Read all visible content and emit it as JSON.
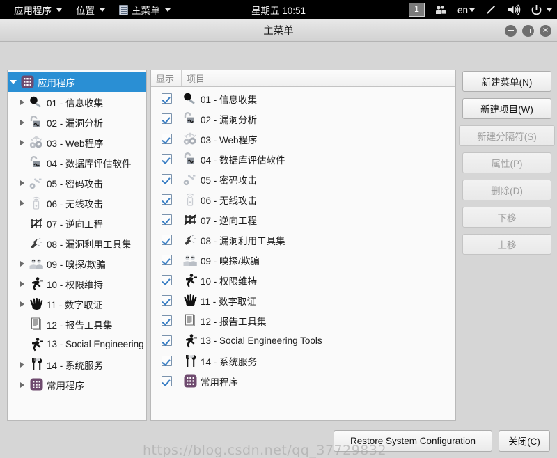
{
  "top_panel": {
    "applications_label": "应用程序",
    "places_label": "位置",
    "main_menu_label": "主菜单",
    "main_menu_icon": "document-list-icon",
    "clock": "星期五 10:51",
    "workspace": "1",
    "video_icon": "video-camera-icon",
    "keyboard_layout": "en",
    "pen_icon": "pen-icon",
    "volume_icon": "speaker-icon",
    "power_icon": "power-icon"
  },
  "window": {
    "title": "主菜单",
    "minimize_icon": "minimize-icon",
    "maximize_icon": "maximize-icon",
    "close_icon": "close-icon"
  },
  "right_table": {
    "columns": [
      "显示",
      "项目"
    ]
  },
  "tree": {
    "root": {
      "label": "应用程序",
      "icon": "app-grid-icon",
      "selected": true,
      "expanded": true
    },
    "items": [
      {
        "label": "01 - 信息收集",
        "icon": "magnifier-icon",
        "expander": true,
        "checked": true
      },
      {
        "label": "02 - 漏洞分析",
        "icon": "padlock-open-icon",
        "expander": true,
        "checked": true
      },
      {
        "label": "03 - Web程序",
        "icon": "spider-gears-icon",
        "expander": true,
        "checked": true
      },
      {
        "label": "04 - 数据库评估软件",
        "icon": "padlock-open-icon",
        "expander": false,
        "checked": true
      },
      {
        "label": "05 - 密码攻击",
        "icon": "key-icon",
        "expander": true,
        "checked": true
      },
      {
        "label": "06 - 无线攻击",
        "icon": "wireless-icon",
        "expander": true,
        "checked": true
      },
      {
        "label": "07 - 逆向工程",
        "icon": "gears-bug-icon",
        "expander": false,
        "checked": true
      },
      {
        "label": "08 - 漏洞利用工具集",
        "icon": "lightning-icon",
        "expander": false,
        "checked": true
      },
      {
        "label": "09 - 嗅探/欺骗",
        "icon": "faces-icon",
        "expander": true,
        "checked": true
      },
      {
        "label": "10 - 权限维持",
        "icon": "running-man-icon",
        "expander": true,
        "checked": true
      },
      {
        "label": "11 - 数字取证",
        "icon": "open-hand-icon",
        "expander": true,
        "checked": true
      },
      {
        "label": "12 - 报告工具集",
        "icon": "documents-icon",
        "expander": false,
        "checked": true
      },
      {
        "label": "13 - Social Engineering Tools",
        "icon": "running-man-icon",
        "expander": false,
        "checked": true
      },
      {
        "label": "14 - 系统服务",
        "icon": "tools-icon",
        "expander": true,
        "checked": true
      },
      {
        "label": "常用程序",
        "icon": "app-grid-icon",
        "expander": true,
        "checked": true
      }
    ]
  },
  "side_buttons": [
    {
      "label": "新建菜单(N)",
      "enabled": true
    },
    {
      "label": "新建项目(W)",
      "enabled": true
    },
    {
      "label": "新建分隔符(S)",
      "enabled": false
    },
    {
      "label": "属性(P)",
      "enabled": false
    },
    {
      "label": "删除(D)",
      "enabled": false
    },
    {
      "label": "下移",
      "enabled": false
    },
    {
      "label": "上移",
      "enabled": false
    }
  ],
  "bottom_buttons": {
    "restore_label": "Restore System Configuration",
    "close_label": "关闭(C)"
  },
  "watermark": "https://blog.csdn.net/qq_37729832",
  "colors": {
    "selection_blue": "#2a8fd4",
    "checkmark_blue": "#3b7fc4",
    "panel_gray": "#d6d6d6",
    "app_icon_purple": "#6e4a6e"
  }
}
